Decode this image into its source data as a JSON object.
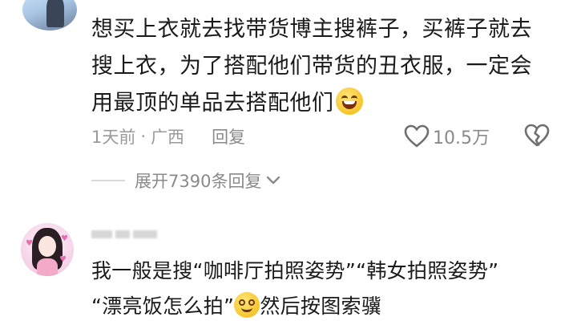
{
  "comment1": {
    "lines": [
      "想买上衣就去找带货博主搜裤子，买裤子就去",
      "搜上衣，为了搭配他们带货的丑衣服，一定会",
      "用最顶的单品去搭配他们"
    ],
    "emoji": "grinning-sweat-emoji",
    "time": "1天前",
    "separator": "·",
    "location": "广西",
    "reply_label": "回复",
    "likes": "10.5万",
    "expand_label": "展开7390条回复"
  },
  "comment2": {
    "lines": [
      "我一般是搜“咖啡厅拍照姿势”“韩女拍照姿势”",
      "“漂亮饭怎么拍”"
    ],
    "tail": "然后按图索骥",
    "emoji": "smiling-emoji"
  },
  "icons": {
    "like": "heart-outline-icon",
    "dislike": "broken-heart-icon",
    "expand": "chevron-down-icon"
  },
  "colors": {
    "text": "#1a1a1a",
    "meta": "#9a9a9a",
    "background": "#ffffff"
  }
}
